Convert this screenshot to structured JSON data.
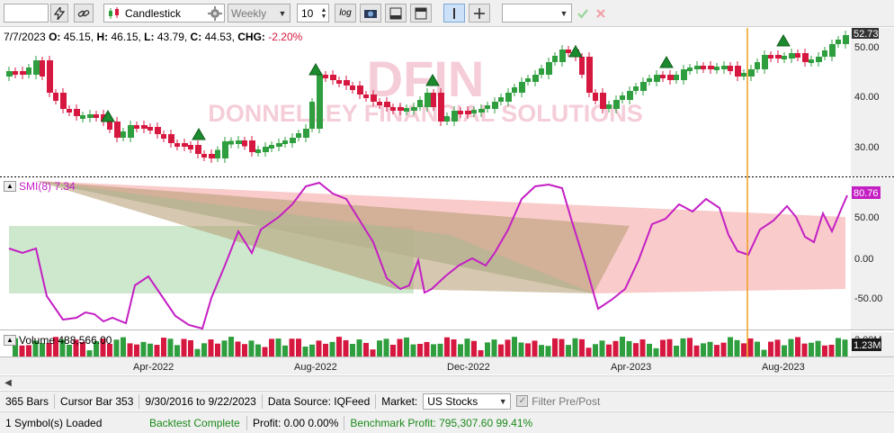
{
  "toolbar": {
    "symbol_value": "",
    "chart_type": "Candlestick",
    "interval": "Weekly",
    "bar_count": "10",
    "log_label": "log",
    "right_input": ""
  },
  "price_pane": {
    "date": "7/7/2023",
    "o_label": "O:",
    "o": "45.15",
    "h_label": "H:",
    "h": "46.15",
    "l_label": "L:",
    "l": "43.79",
    "c_label": "C:",
    "c": "44.53",
    "chg_label": "CHG:",
    "chg": "-2.20%",
    "watermark_symbol": "DFIN",
    "watermark_name": "DONNELLEY FINANCIAL SOLUTIONS",
    "last_price": "52.73",
    "axis_ticks": [
      "50.00",
      "40.00",
      "30.00"
    ]
  },
  "smi_pane": {
    "title": "SMI(8) 7.34",
    "last_value": "80.76",
    "axis_ticks": [
      "50.00",
      "0.00",
      "-50.00"
    ]
  },
  "volume_pane": {
    "title": "Volume 488,566.00",
    "last_value": "1.23M",
    "hidden_tick": "2.00M"
  },
  "x_axis": {
    "labels": [
      "Apr-2022",
      "Aug-2022",
      "Dec-2022",
      "Apr-2023",
      "Aug-2023"
    ]
  },
  "status1": {
    "bars": "365 Bars",
    "cursor": "Cursor Bar 353",
    "range": "9/30/2016 to 9/22/2023",
    "datasource": "Data Source: IQFeed",
    "market_label": "Market:",
    "market_value": "US Stocks",
    "filter_label": "Filter Pre/Post"
  },
  "status2": {
    "loaded": "1 Symbol(s) Loaded",
    "backtest": "Backtest Complete",
    "profit": "Profit: 0.00 0.00%",
    "benchmark": "Benchmark Profit: 795,307.60 99.41%"
  },
  "colors": {
    "up": "#2e9e3e",
    "down": "#d6173f",
    "smi": "#c41fc4",
    "cursor": "#f0a020",
    "chg": "#d6173f",
    "backtest": "#1a8a1a",
    "benchmark": "#1a8a1a",
    "watermark": "#f3c6d2"
  }
}
